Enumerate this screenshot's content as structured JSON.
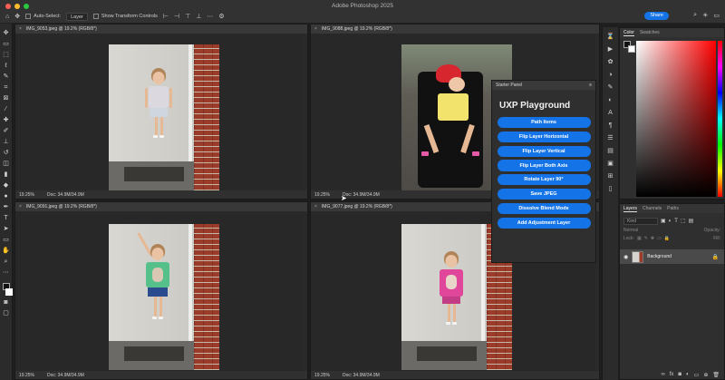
{
  "app": {
    "title": "Adobe Photoshop 2025",
    "options": {
      "auto_select_label": "Auto-Select:",
      "auto_select_value": "Layer",
      "show_transform_label": "Show Transform Controls"
    },
    "share_label": "Share"
  },
  "documents": [
    {
      "tab": "IMG_9053.jpeg @ 19.2% (RGB/8*)",
      "zoom": "19.25%",
      "doc_size": "Doc: 34.9M/34.9M"
    },
    {
      "tab": "IMG_9088.jpeg @ 19.2% (RGB/8*)",
      "zoom": "19.25%",
      "doc_size": "Doc: 34.9M/34.9M"
    },
    {
      "tab": "IMG_9091.jpeg @ 19.2% (RGB/8*)",
      "zoom": "19.25%",
      "doc_size": "Doc: 34.9M/34.9M"
    },
    {
      "tab": "IMG_9077.jpeg @ 19.2% (RGB/8*)",
      "zoom": "19.25%",
      "doc_size": "Doc: 34.9M/34.9M"
    }
  ],
  "starter_panel": {
    "header": "Starter Panel",
    "title": "UXP Playground",
    "buttons": [
      "Path Items",
      "Flip Layer Horizontal",
      "Flip Layer Vertical",
      "Flip Layer Both Axis",
      "Rotate Layer 90°",
      "Save JPEG",
      "Dissolve Blend Mode",
      "Add Adjustment Layer"
    ]
  },
  "color_panel": {
    "tabs": [
      "Color",
      "Swatches"
    ]
  },
  "layers_panel": {
    "tabs": [
      "Layers",
      "Channels",
      "Paths"
    ],
    "search_placeholder": "Kind",
    "blend_mode": "Normal",
    "opacity_label": "Opacity:",
    "lock_label": "Lock:",
    "fill_label": "Fill:",
    "layers": [
      {
        "name": "Background",
        "visible": true,
        "locked": true
      }
    ]
  },
  "colors": {
    "accent": "#1473e6",
    "panel_bg": "#2f2f2f",
    "app_bg": "#1e1e1e"
  }
}
